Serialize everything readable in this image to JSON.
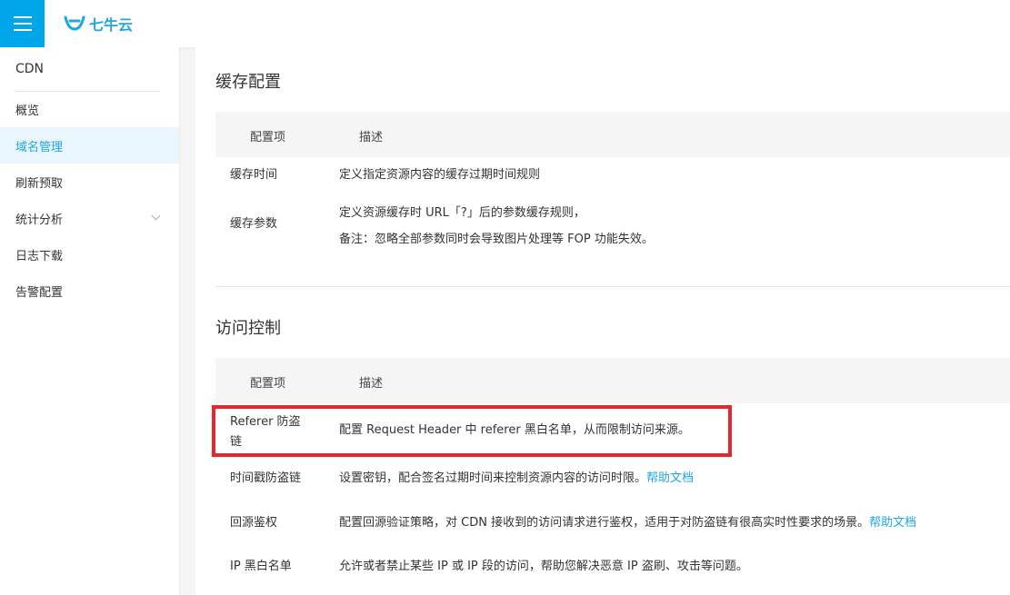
{
  "brand": {
    "logo_text": "七牛云",
    "accent": "#00a6ea",
    "highlight_color": "#e8252a"
  },
  "sidebar": {
    "title": "CDN",
    "items": [
      {
        "label": "概览"
      },
      {
        "label": "域名管理",
        "active": true
      },
      {
        "label": "刷新预取"
      },
      {
        "label": "统计分析",
        "expandable": true
      },
      {
        "label": "日志下载"
      },
      {
        "label": "告警配置"
      }
    ]
  },
  "cache": {
    "title": "缓存配置",
    "header": {
      "col1": "配置项",
      "col2": "描述"
    },
    "rows": [
      {
        "name": "缓存时间",
        "desc": "定义指定资源内容的缓存过期时间规则"
      },
      {
        "name": "缓存参数",
        "desc": "定义资源缓存时 URL「?」后的参数缓存规则，",
        "desc2": "备注：忽略全部参数同时会导致图片处理等 FOP 功能失效。"
      }
    ]
  },
  "access": {
    "title": "访问控制",
    "header": {
      "col1": "配置项",
      "col2": "描述"
    },
    "rows": [
      {
        "name_line1": "Referer 防盗",
        "name_line2": "链",
        "desc": "配置 Request Header 中 referer 黑白名单，从而限制访问来源。"
      },
      {
        "name": "时间戳防盗链",
        "desc": "设置密钥，配合签名过期时间来控制资源内容的访问时限。",
        "link": "帮助文档"
      },
      {
        "name": "回源鉴权",
        "desc": "配置回源验证策略，对 CDN 接收到的访问请求进行鉴权，适用于对防盗链有很高实时性要求的场景。",
        "link": "帮助文档"
      },
      {
        "name": "IP 黑白名单",
        "desc": "允许或者禁止某些 IP 或 IP 段的访问，帮助您解决恶意 IP 盗刷、攻击等问题。"
      }
    ]
  }
}
